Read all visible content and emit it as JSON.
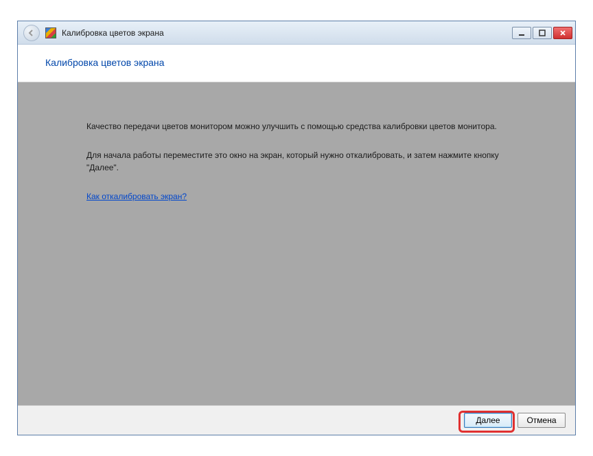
{
  "window": {
    "title": "Калибровка цветов экрана"
  },
  "header": {
    "title": "Калибровка цветов экрана"
  },
  "content": {
    "paragraph1": "Качество передачи цветов монитором можно улучшить с помощью средства калибровки цветов монитора.",
    "paragraph2": "Для начала работы переместите это окно на экран, который нужно откалибровать, и затем нажмите кнопку \"Далее\".",
    "help_link": "Как откалибровать экран?"
  },
  "footer": {
    "next_label": "Далее",
    "cancel_label": "Отмена"
  }
}
